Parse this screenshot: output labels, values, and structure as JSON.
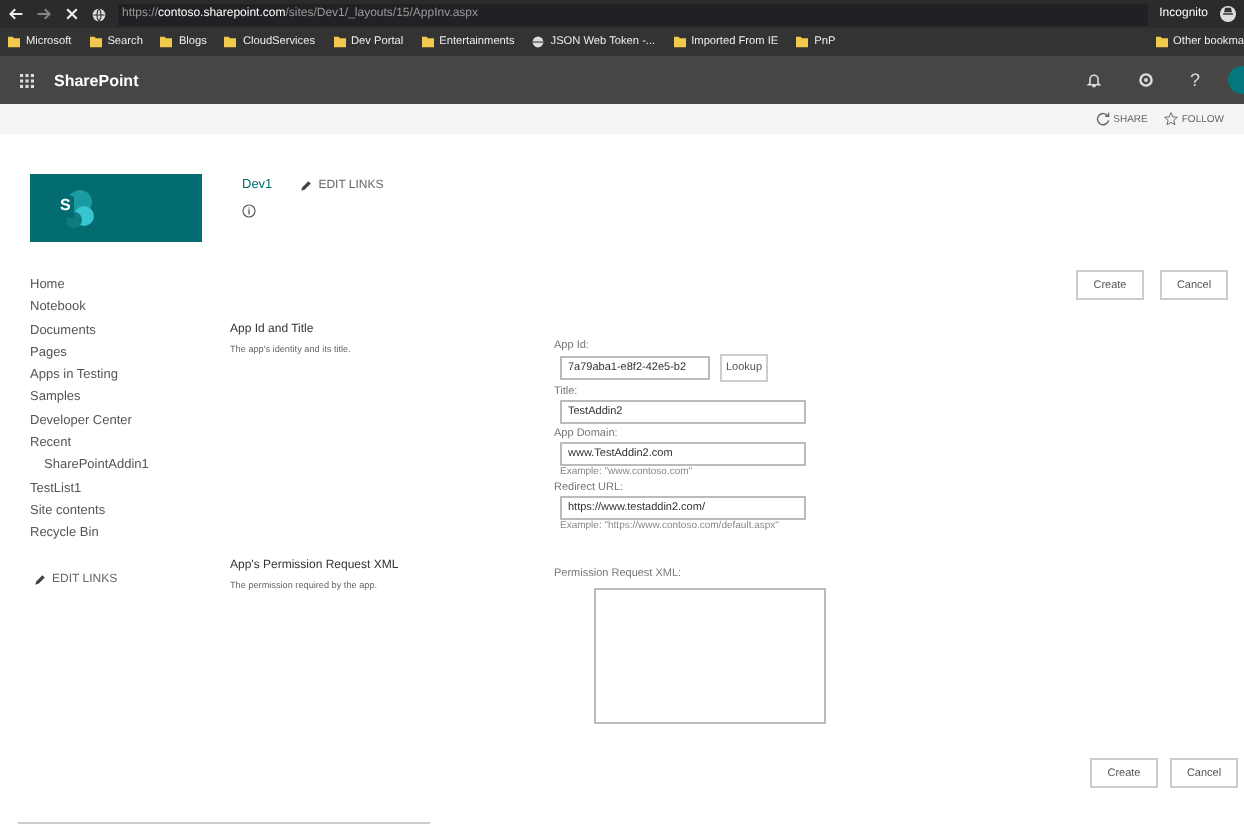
{
  "browser": {
    "url": "https://**contoso.sharepoint.com**/sites/Dev1/_layouts/15/AppInv.aspx",
    "profile": "Incognito",
    "bookmarks": [
      {
        "label": "Microsoft",
        "kind": "folder"
      },
      {
        "label": "Search",
        "kind": "folder"
      },
      {
        "label": "Blogs",
        "kind": "folder"
      },
      {
        "label": "CloudServices",
        "kind": "folder"
      },
      {
        "label": "Dev Portal",
        "kind": "folder"
      },
      {
        "label": "Entertainments",
        "kind": "folder"
      },
      {
        "label": "JSON Web Token -...",
        "kind": "site"
      },
      {
        "label": "Imported From IE",
        "kind": "folder"
      },
      {
        "label": "PnP",
        "kind": "folder"
      }
    ],
    "other_bookmarks": "Other bookma"
  },
  "suite_bar": {
    "title": "SharePoint",
    "help": "?"
  },
  "command_bar": {
    "share": "SHARE",
    "follow": "FOLLOW"
  },
  "site": {
    "logo_letter": "S",
    "name": "Dev1",
    "edit_links": "EDIT LINKS"
  },
  "nav": {
    "items": [
      {
        "label": "Home"
      },
      {
        "label": "Notebook"
      },
      {
        "label": "Documents"
      },
      {
        "label": "Pages"
      },
      {
        "label": "Apps in Testing"
      },
      {
        "label": "Samples"
      },
      {
        "label": "Developer Center"
      },
      {
        "label": "Recent",
        "children": [
          {
            "label": "SharePointAddin1"
          }
        ]
      },
      {
        "label": "TestList1"
      },
      {
        "label": "Site contents"
      },
      {
        "label": "Recycle Bin"
      }
    ],
    "edit_links": "EDIT LINKS"
  },
  "top_buttons": [
    "Create",
    "Cancel"
  ],
  "sections": [
    {
      "title": "App Id and Title",
      "description": "The app's identity and its title."
    },
    {
      "title": "App's Permission Request XML",
      "description": "The permission required by the app."
    }
  ],
  "form": {
    "app_id": {
      "label": "App Id:",
      "value": "7a79aba1-e8f2-42e5-b2",
      "button": "Lookup"
    },
    "title": {
      "label": "Title:",
      "value": "TestAddin2"
    },
    "app_domain": {
      "label": "App Domain:",
      "value": "www.TestAddin2.com",
      "example": "Example: \"www.contoso.com\""
    },
    "redirect_url": {
      "label": "Redirect URL:",
      "value": "https://www.testaddin2.com/",
      "example": "Example: \"https://www.contoso.com/default.aspx\""
    },
    "permission_xml": {
      "label": "Permission Request XML:"
    }
  },
  "bottom_buttons": [
    "Create",
    "Cancel"
  ]
}
